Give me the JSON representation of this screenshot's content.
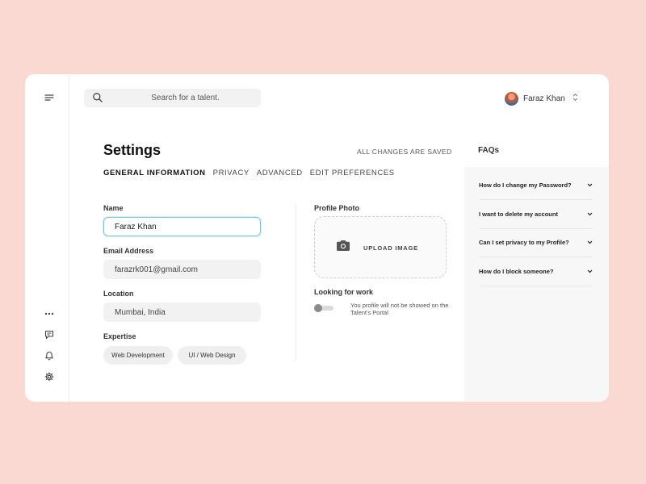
{
  "search": {
    "placeholder": "Search for a talent."
  },
  "user": {
    "name": "Faraz Khan"
  },
  "page": {
    "title": "Settings",
    "save_status": "ALL CHANGES ARE SAVED"
  },
  "tabs": [
    {
      "label": "GENERAL INFORMATION",
      "active": true
    },
    {
      "label": "PRIVACY",
      "active": false
    },
    {
      "label": "ADVANCED",
      "active": false
    },
    {
      "label": "EDIT PREFERENCES",
      "active": false
    }
  ],
  "form": {
    "name": {
      "label": "Name",
      "value": "Faraz Khan"
    },
    "email": {
      "label": "Email Address",
      "value": "farazrk001@gmail.com"
    },
    "location": {
      "label": "Location",
      "value": "Mumbai, India"
    },
    "expertise": {
      "label": "Expertise",
      "chips": [
        "Web Development",
        "UI / Web Design"
      ]
    }
  },
  "profile_photo": {
    "label": "Profile Photo",
    "upload_label": "UPLOAD IMAGE"
  },
  "looking_for_work": {
    "label": "Looking for work",
    "enabled": false,
    "description": "You profile will not be showed on the Talent's Portal"
  },
  "faqs": {
    "title": "FAQs",
    "items": [
      "How do I change my Password?",
      "I want to delete my account",
      "Can I set privacy to my Profile?",
      "How do I block someone?"
    ]
  },
  "icons": {
    "rail": [
      "menu-icon",
      "more-icon",
      "chat-icon",
      "bell-icon",
      "gear-icon"
    ],
    "search": "search-icon",
    "upload": "camera-icon",
    "faq": "chevron-down-icon"
  },
  "colors": {
    "background": "#fbd9d3",
    "focus_border": "#7cc4e6",
    "faq_panel": "#f7f7f7"
  }
}
